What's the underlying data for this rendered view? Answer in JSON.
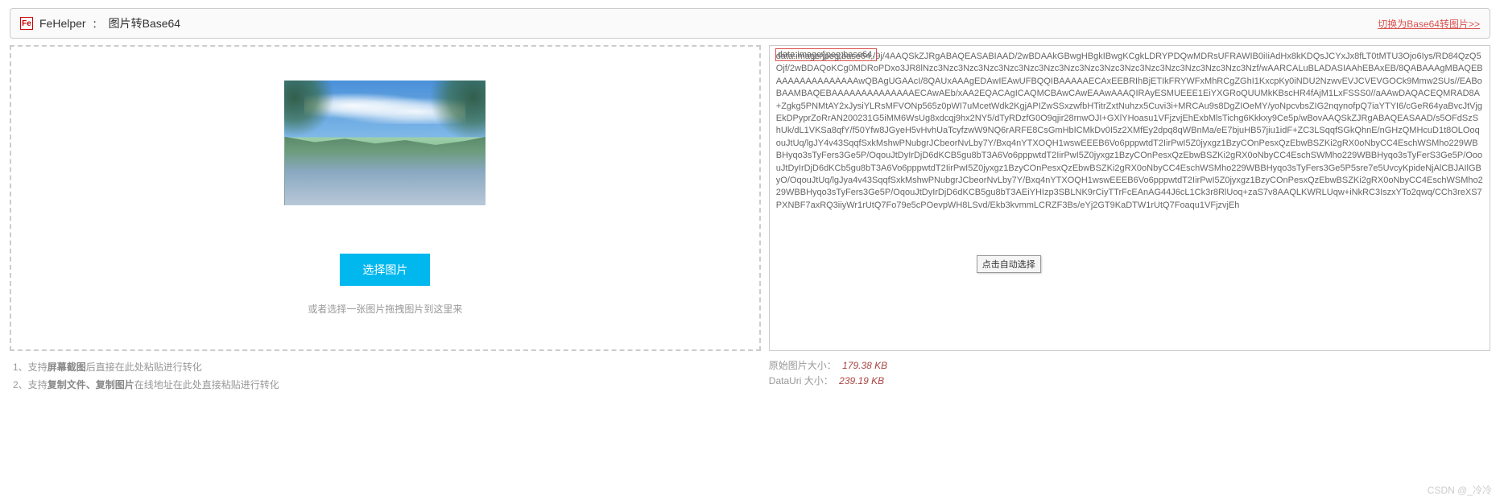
{
  "header": {
    "logo_text": "Fe",
    "app_name": "FeHelper",
    "separator": "：",
    "page_title": "图片转Base64",
    "switch_link": "切换为Base64转图片>>"
  },
  "left": {
    "select_button": "选择图片",
    "drop_hint": "或者选择一张图片拖拽图片到这里来",
    "tip1_prefix": "1、支持",
    "tip1_bold": "屏幕截图",
    "tip1_suffix": "后直接在此处粘贴进行转化",
    "tip2_prefix": "2、支持",
    "tip2_bold": "复制文件、复制图片",
    "tip2_suffix": "在线地址在此处直接粘贴进行转化"
  },
  "right": {
    "highlight_prefix": "data:image/jpeg;base64,",
    "base64_content": "data:image/jpeg;base64,/9j/4AAQSkZJRgABAQEASABIAAD/2wBDAAkGBwgHBgkIBwgKCgkLDRYPDQwMDRsUFRAWIB0iIiAdHx8kKDQsJCYxJx8fLT0tMTU3Ojo6Iys/RD84QzQ5Ojf/2wBDAQoKCg0MDRoPDxo3JR8lNzc3Nzc3Nzc3Nzc3Nzc3Nzc3Nzc3Nzc3Nzc3Nzc3Nzc3Nzc3Nzc3Nzc3Nzc3Nzc3Nzf/wAARCALuBLADASIAAhEBAxEB/8QABAAAgMBAQEBAAAAAAAAAAAAAAwQBAgUGAAcI/8QAUxAAAgEDAwIEAwUFBQQIBAAAAAECAxEEBRIhBjETIkFRYWFxMhRCgZGhI1KxcpKy0iNDU2NzwvEVJCVEVGOCk9Mmw2SUs//EABoBAAMBAQEBAAAAAAAAAAAAAAECAwAEb/xAA2EQACAgICAQMCBAwCAwEAAwAAAQIRAyESMUEEE1EiYXGRoQUUMkKBscHR4fAjM1LxFSSS0//aAAwDAQACEQMRAD8A+Zgkg5PNMtAY2xJysiYLRsMFVONp565z0pWI7uMcetWdk2KgjAPIZwSSxzwfbHTitrZxtNuhzx5Cuvi3i+MRCAu9s8DgZIOeMY/yoNpcvbsZIG2nqynofpQ7iaYTYI6/cGeR64yaBvcJtVjgEkDPyprZoRrAN200231G5iMM6WsUg8xdcqj9hx2NY5/dTyRDzfG0O9qjir28rnwOJI+GXlYHoasu1VFjzvjEhExbMlsTichg6Kkkxy9Ce5p/wBovAAQSkZJRgABAQEASAAD/s5OFdSzShUk/dL1VKSa8qfY/f50Yfw8JGyeH5vHvhUaTcyfzwW9NQ6rARFE8CsGmHbICMkDv0I5z2XMfEy2dpq8qWBnMa/eE7bjuHB57jiu1idF+ZC3LSqqfSGkQhnE/nGHzQMHcuD1t8OLOoqouJtUq/lgJY4v43SqqfSxkMshwPNubgrJCbeorNvLby7Y/Bxq4nYTXOQH1wswEEEB6Vo6pppwtdT2IirPwI5Z0jyxgz1BzyCOnPesxQzEbwBSZKi2gRX0oNbyCC4EschWSMho229WBBHyqo3sTyFers3Ge5P/OqouJtDyIrDjD6dKCB5gu8bT3A6Vo6pppwtdT2IirPwI5Z0jyxgz1BzyCOnPesxQzEbwBSZKi2gRX0oNbyCC4EschSWMho229WBBHyqo3sTyFerS3Ge5P/OoouJtDyIrDjD6dKCb5gu8bT3A6Vo6pppwtdT2IirPwI5Z0jyxgz1BzyCOnPesxQzEbwBSZKi2gRX0oNbyCC4EschWSMho229WBBHyqo3sTyFers3Ge5P5sre7e5UvcyKpideNjAlCBJAIlGByO/OqouJtUq/lgJya4v43SqqfSxkMshwPNubgrJCbeorNvLby7Y/Bxq4nYTXOQH1wswEEEB6Vo6pppwtdT2IirPwI5Z0jyxgz1BzyCOnPesxQzEbwBSZKi2gRX0oNbyCC4EschWSMho229WBBHyqo3sTyFers3Ge5P/OqouJtDyIrDjD6dKCB5gu8bT3AEiYHIzp3SBLNK9rCiyTTrFcEAnAG44J6cL1Ck3r8RlUoq+zaS7v8AAQLKWRLUqw+iNkRC3IszxYTo2qwq/CCh3reXS7PXNBF7axRQ3iiyWr1rUtQ7Fo79e5cPOevpWH8LSvd/Ekb3kvmmLCRZF3Bs/eYj2GT9KaDTW1rUtQ7Foaqu1VFjzvjEh",
    "tooltip": "点击自动选择",
    "original_size_label": "原始图片大小：",
    "original_size_value": "179.38 KB",
    "datauri_size_label": "DataUri 大小：",
    "datauri_size_value": "239.19 KB"
  },
  "watermark": "CSDN @_冷冷"
}
